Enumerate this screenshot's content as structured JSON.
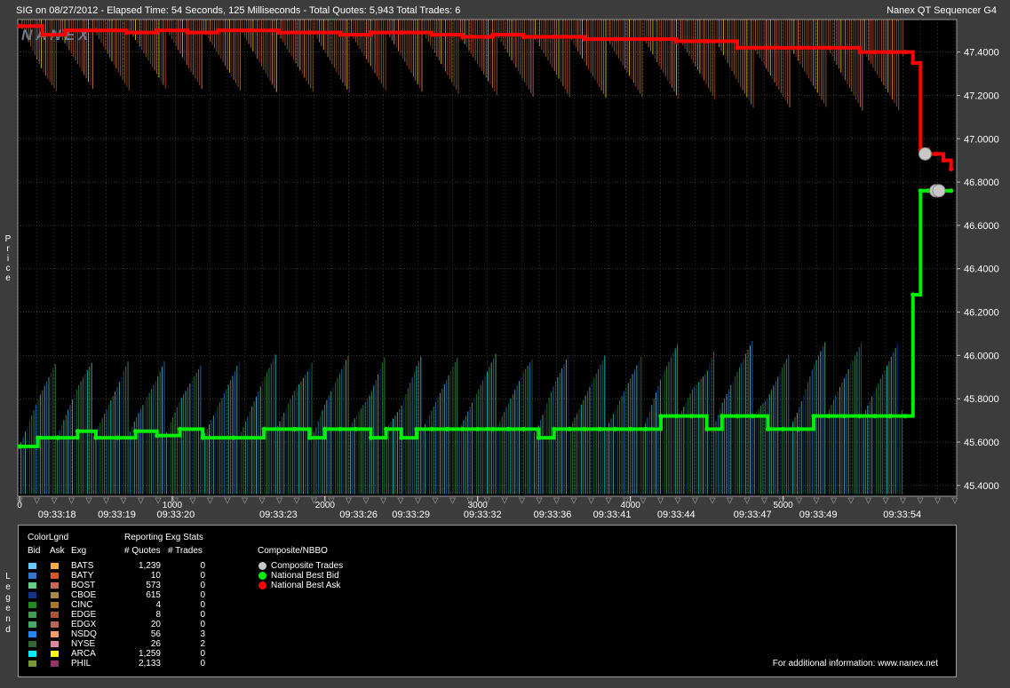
{
  "header": {
    "title": "SIG on 08/27/2012  -  Elapsed Time: 54 Seconds, 125 Milliseconds  -  Total Quotes: 5,943  Total Trades: 6",
    "app_name": "Nanex QT Sequencer G4",
    "watermark": "NANEX"
  },
  "chart_data": {
    "type": "line",
    "ylabel": "Price",
    "left_label": "Legend",
    "ylim": [
      45.35,
      47.55
    ],
    "xlim": [
      0,
      6125
    ],
    "y_ticks": [
      "47.4000",
      "47.2000",
      "47.0000",
      "46.8000",
      "46.6000",
      "46.4000",
      "46.2000",
      "46.0000",
      "45.8000",
      "45.6000",
      "45.4000"
    ],
    "y_tick_values": [
      47.4,
      47.2,
      47.0,
      46.8,
      46.6,
      46.4,
      46.2,
      46.0,
      45.8,
      45.6,
      45.4
    ],
    "x_ticks": [
      {
        "label": "0",
        "value": 0
      },
      {
        "label": "1000",
        "value": 1000
      },
      {
        "label": "2000",
        "value": 2000
      },
      {
        "label": "3000",
        "value": 3000
      },
      {
        "label": "4000",
        "value": 4000
      },
      {
        "label": "5000",
        "value": 5000
      }
    ],
    "time_labels": [
      {
        "label": "09:33:18",
        "value": 245
      },
      {
        "label": "09:33:19",
        "value": 637
      },
      {
        "label": "09:33:20",
        "value": 1023
      },
      {
        "label": "09:33:23",
        "value": 1695
      },
      {
        "label": "09:33:26",
        "value": 2220
      },
      {
        "label": "09:33:29",
        "value": 2563
      },
      {
        "label": "09:33:32",
        "value": 3032
      },
      {
        "label": "09:33:36",
        "value": 3490
      },
      {
        "label": "09:33:41",
        "value": 3880
      },
      {
        "label": "09:33:44",
        "value": 4300
      },
      {
        "label": "09:33:47",
        "value": 4800
      },
      {
        "label": "09:33:49",
        "value": 5230
      },
      {
        "label": "09:33:54",
        "value": 5780
      }
    ],
    "series": [
      {
        "name": "National Best Bid",
        "color": "#00ee00",
        "x": [
          0,
          120,
          250,
          380,
          500,
          640,
          760,
          900,
          1050,
          1200,
          1400,
          1600,
          1800,
          1900,
          2000,
          2100,
          2200,
          2300,
          2400,
          2500,
          2600,
          2700,
          2800,
          2900,
          3000,
          3100,
          3200,
          3300,
          3400,
          3500,
          3600,
          3700,
          3800,
          3900,
          4000,
          4100,
          4200,
          4300,
          4400,
          4500,
          4600,
          4700,
          4800,
          4900,
          5000,
          5100,
          5200,
          5300,
          5400,
          5500,
          5600,
          5700,
          5800,
          5850,
          5900,
          5950,
          6000,
          6050,
          6100
        ],
        "y": [
          45.58,
          45.62,
          45.62,
          45.65,
          45.62,
          45.62,
          45.65,
          45.63,
          45.66,
          45.62,
          45.62,
          45.66,
          45.66,
          45.62,
          45.66,
          45.66,
          45.66,
          45.62,
          45.66,
          45.62,
          45.66,
          45.66,
          45.66,
          45.66,
          45.66,
          45.66,
          45.66,
          45.66,
          45.62,
          45.66,
          45.66,
          45.66,
          45.66,
          45.66,
          45.66,
          45.66,
          45.72,
          45.72,
          45.72,
          45.66,
          45.72,
          45.72,
          45.72,
          45.66,
          45.66,
          45.66,
          45.72,
          45.72,
          45.72,
          45.72,
          45.72,
          45.72,
          45.72,
          46.28,
          46.76,
          46.76,
          46.76,
          46.76,
          46.76
        ]
      },
      {
        "name": "National Best Ask",
        "color": "#ff0000",
        "x": [
          0,
          150,
          300,
          500,
          700,
          900,
          1100,
          1300,
          1500,
          1700,
          1900,
          2100,
          2300,
          2500,
          2700,
          2900,
          3100,
          3300,
          3500,
          3700,
          3900,
          4100,
          4300,
          4500,
          4700,
          4900,
          5100,
          5300,
          5500,
          5600,
          5700,
          5800,
          5850,
          5900,
          5950,
          6000,
          6050,
          6100
        ],
        "y": [
          47.52,
          47.48,
          47.5,
          47.5,
          47.49,
          47.5,
          47.49,
          47.5,
          47.5,
          47.49,
          47.49,
          47.48,
          47.49,
          47.49,
          47.48,
          47.47,
          47.48,
          47.47,
          47.47,
          47.46,
          47.46,
          47.46,
          47.45,
          47.45,
          47.42,
          47.42,
          47.42,
          47.42,
          47.4,
          47.4,
          47.4,
          47.4,
          47.35,
          46.95,
          46.93,
          46.93,
          46.9,
          46.86
        ]
      },
      {
        "name": "Composite Trades",
        "color": "#c8c8c8",
        "x": [
          5930,
          6000,
          6020
        ],
        "y": [
          46.93,
          46.76,
          46.76
        ]
      }
    ]
  },
  "legend": {
    "headers": {
      "colorlgnd": "ColorLgnd",
      "bid": "Bid",
      "ask": "Ask",
      "exg": "Exg",
      "stats": "Reporting Exg Stats",
      "quotes": "# Quotes",
      "trades": "# Trades",
      "composite": "Composite/NBBO"
    },
    "rows": [
      {
        "exg": "BATS",
        "quotes": "1,239",
        "trades": "0",
        "bid_color": "#66ccff",
        "ask_color": "#ffaa44"
      },
      {
        "exg": "BATY",
        "quotes": "10",
        "trades": "0",
        "bid_color": "#3377cc",
        "ask_color": "#dd5522"
      },
      {
        "exg": "BOST",
        "quotes": "573",
        "trades": "0",
        "bid_color": "#66cc88",
        "ask_color": "#cc6655"
      },
      {
        "exg": "CBOE",
        "quotes": "615",
        "trades": "0",
        "bid_color": "#113388",
        "ask_color": "#aa8844"
      },
      {
        "exg": "CINC",
        "quotes": "4",
        "trades": "0",
        "bid_color": "#228822",
        "ask_color": "#aa7722"
      },
      {
        "exg": "EDGE",
        "quotes": "8",
        "trades": "0",
        "bid_color": "#449955",
        "ask_color": "#aa5533"
      },
      {
        "exg": "EDGX",
        "quotes": "20",
        "trades": "0",
        "bid_color": "#44aa66",
        "ask_color": "#bb6655"
      },
      {
        "exg": "NSDQ",
        "quotes": "56",
        "trades": "3",
        "bid_color": "#2288ee",
        "ask_color": "#ff9966"
      },
      {
        "exg": "NYSE",
        "quotes": "26",
        "trades": "2",
        "bid_color": "#336633",
        "ask_color": "#dd8899"
      },
      {
        "exg": "ARCA",
        "quotes": "1,259",
        "trades": "0",
        "bid_color": "#00eeff",
        "ask_color": "#ffff00"
      },
      {
        "exg": "PHIL",
        "quotes": "2,133",
        "trades": "0",
        "bid_color": "#779933",
        "ask_color": "#993366"
      }
    ],
    "composite_items": [
      {
        "label": "Composite Trades",
        "color": "#c8c8c8"
      },
      {
        "label": "National Best Bid",
        "color": "#00ee00"
      },
      {
        "label": "National Best Ask",
        "color": "#ff0000"
      }
    ],
    "footer": "For additional information: www.nanex.net"
  }
}
